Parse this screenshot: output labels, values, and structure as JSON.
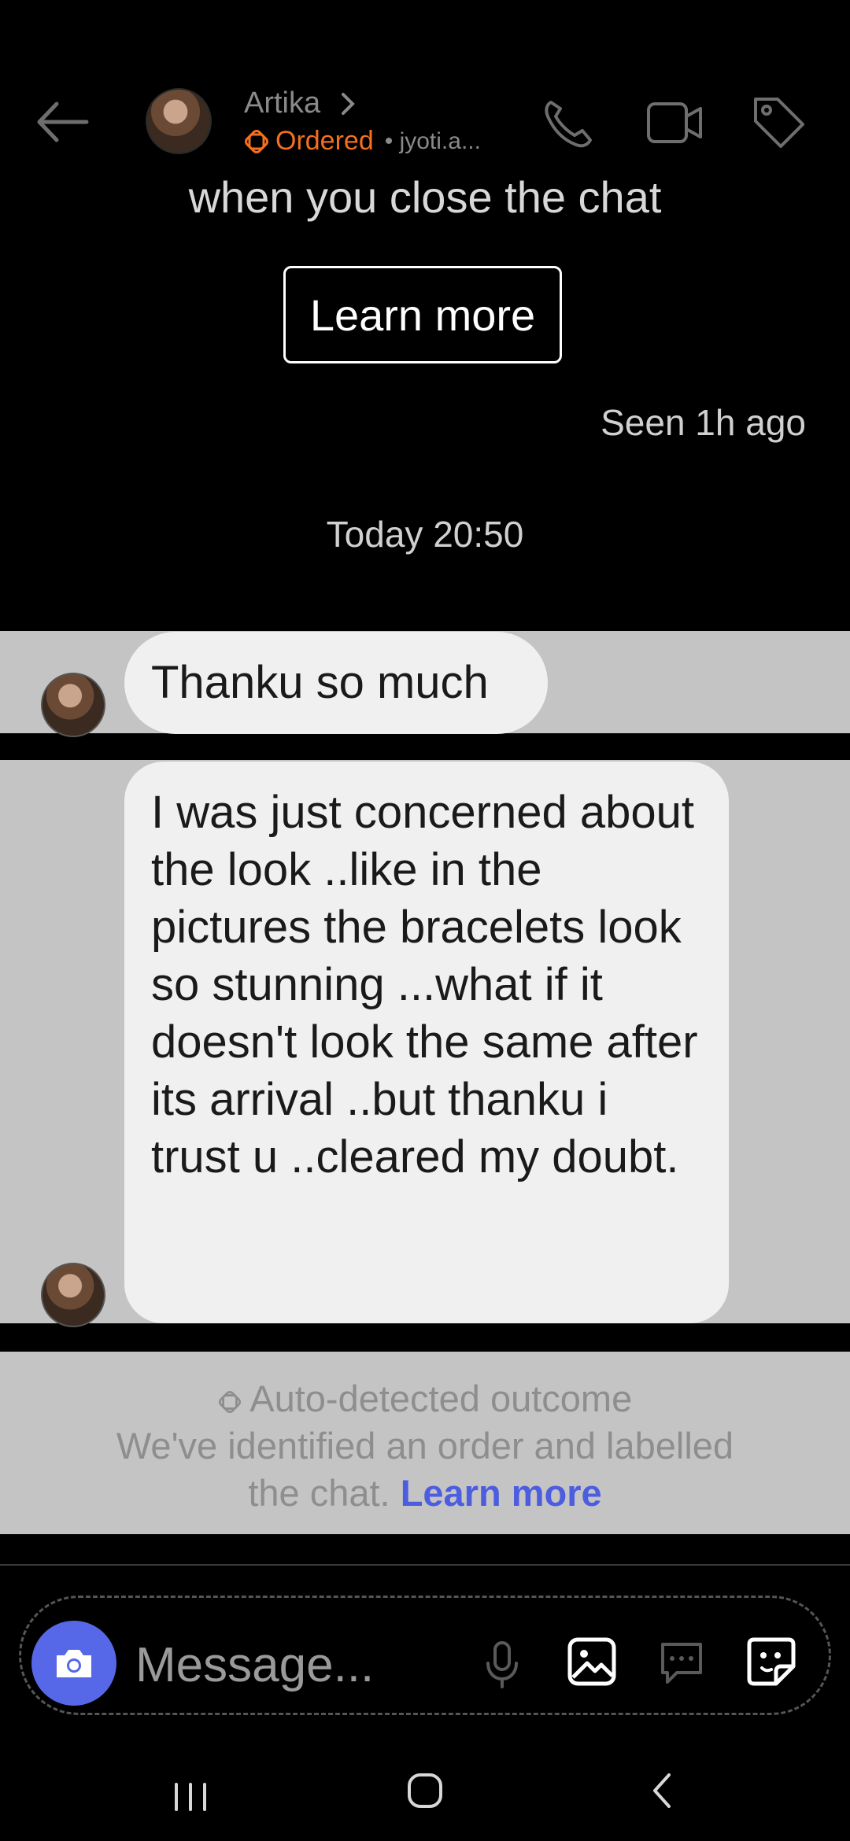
{
  "header": {
    "contact_name": "Artika",
    "status_label": "Ordered",
    "handle": "• jyoti.a...",
    "status_color": "#f2701e",
    "icons": [
      "back-arrow-icon",
      "chevron-right-icon",
      "phone-icon",
      "video-call-icon",
      "tag-icon"
    ]
  },
  "notice": {
    "text": "when you close the chat",
    "button_label": "Learn more"
  },
  "seen_status": "Seen 1h ago",
  "date_separator": "Today 20:50",
  "messages": [
    {
      "text": "Thanku so much"
    },
    {
      "text": "I was just concerned about the look ..like in the pictures the bracelets look so stunning ...what if it doesn't look the same after its arrival ..but thanku i trust u ..cleared my doubt."
    }
  ],
  "outcome": {
    "title": "Auto-detected outcome",
    "body": "We've identified an order and labelled the chat.",
    "link_label": "Learn more",
    "link_color": "#4d5de0"
  },
  "composer": {
    "placeholder": "Message...",
    "accent_color": "#5667e8",
    "icons": [
      "camera-icon",
      "microphone-icon",
      "gallery-icon",
      "chat-bubble-icon",
      "sticker-icon"
    ]
  },
  "navbar": {
    "icons": [
      "recent-apps-icon",
      "home-icon",
      "back-icon"
    ]
  }
}
